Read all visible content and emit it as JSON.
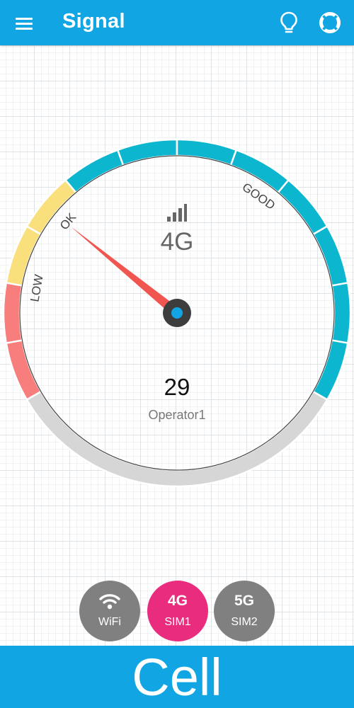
{
  "header": {
    "title": "Signal",
    "menu_icon": "hamburger-menu-icon",
    "tip_icon": "lightbulb-icon",
    "help_icon": "lifebuoy-icon",
    "background": "#11a6e3"
  },
  "gauge": {
    "network_type": "4G",
    "signal_icon": "signal-bars-icon",
    "value": "29",
    "operator": "Operator1",
    "zone_labels": {
      "low": "LOW",
      "ok": "OK",
      "good": "GOOD"
    },
    "colors": {
      "low": "#f77e7c",
      "ok": "#fae07d",
      "good": "#0cb6cf",
      "inactive": "#d6d6d6",
      "needle": "#f0564f",
      "hub": "#3d3d3d",
      "hub_center": "#11a6e3"
    }
  },
  "sim_selector": {
    "wifi": {
      "label": "WiFi",
      "icon": "wifi-icon",
      "active": false
    },
    "sim1": {
      "big": "4G",
      "label": "SIM1",
      "active": true
    },
    "sim2": {
      "big": "5G",
      "label": "SIM2",
      "active": false
    },
    "active_color": "#ea2c7f",
    "inactive_color": "#808080"
  },
  "footer": {
    "mode_label": "Cell"
  }
}
